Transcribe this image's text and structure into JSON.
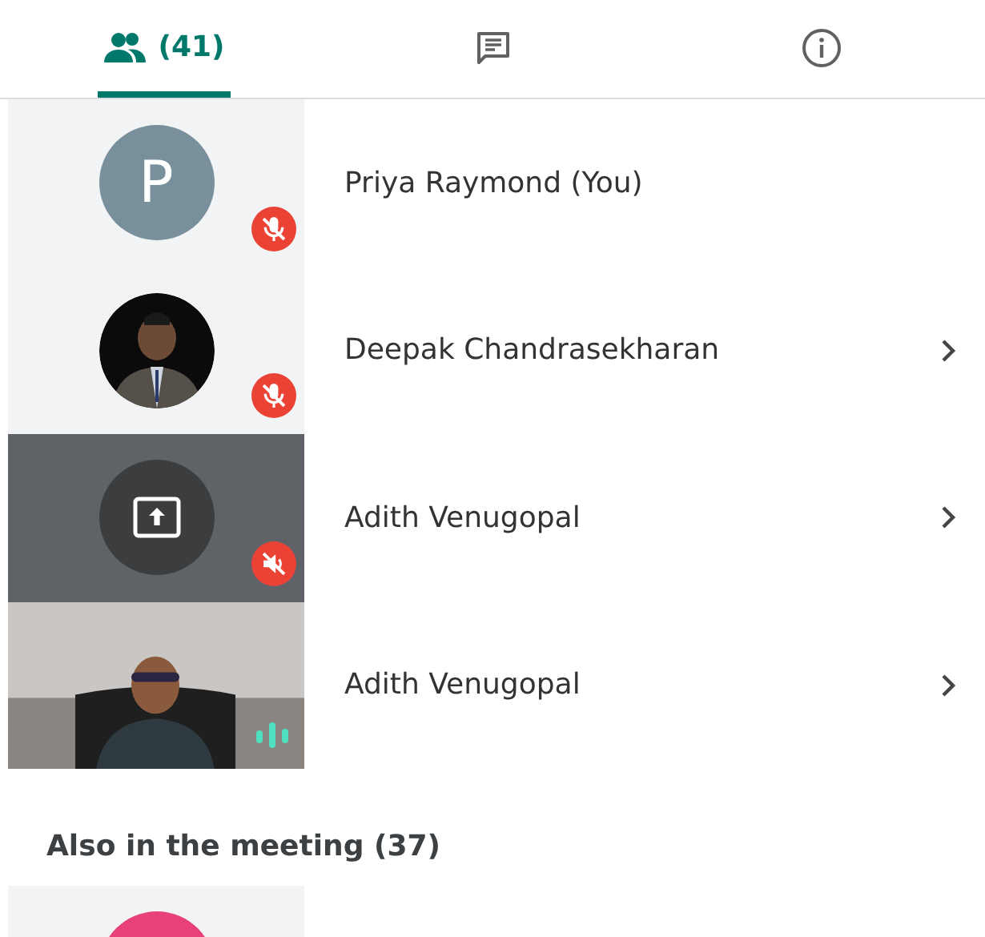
{
  "tabs": [
    {
      "kind": "people",
      "label": "(41)",
      "selected": true
    },
    {
      "kind": "chat",
      "selected": false
    },
    {
      "kind": "info",
      "selected": false
    }
  ],
  "participants": [
    {
      "kind": "avatar",
      "initial": "P",
      "color": "#78909c",
      "badge": {
        "kind": "mic-off"
      },
      "name": "Priya Raymond (You)",
      "chevron": false
    },
    {
      "badge": {
        "kind": "mic-off"
      },
      "name": "Deepak Chandrasekharan",
      "chevron": true
    },
    {
      "kind": "screen-share",
      "badge": {
        "kind": "speaker-off"
      },
      "name": "Adith Venugopal",
      "chevron": true
    },
    {
      "kind": "video",
      "badge": {
        "kind": "speaking"
      },
      "name": "Adith Venugopal",
      "chevron": true
    }
  ],
  "also_in_meeting": {
    "heading": "Also in the meeting (37)",
    "participants": [
      {
        "kind": "avatar",
        "color": "#e8407a"
      }
    ]
  }
}
